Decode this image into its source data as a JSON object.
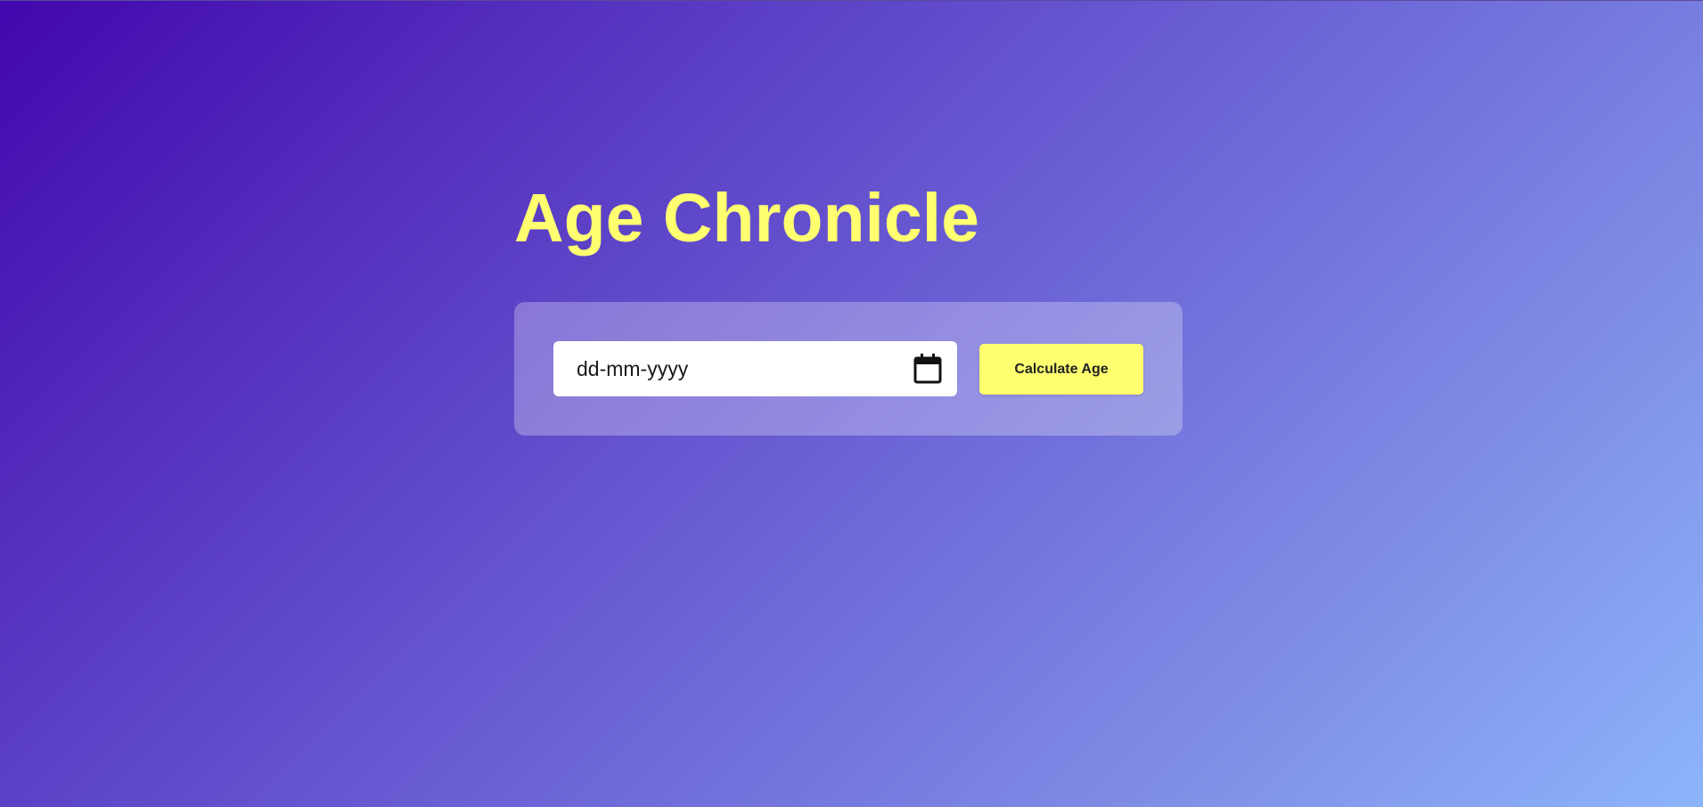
{
  "app": {
    "title": "Age Chronicle"
  },
  "form": {
    "date_input": {
      "placeholder": "dd-mm-yyyy",
      "value": ""
    },
    "calculate_label": "Calculate Age"
  },
  "icons": {
    "date_picker": "calendar-icon"
  },
  "colors": {
    "accent": "#ffff70",
    "gradient_start": "#4207ad",
    "gradient_end": "#8db4fb"
  }
}
